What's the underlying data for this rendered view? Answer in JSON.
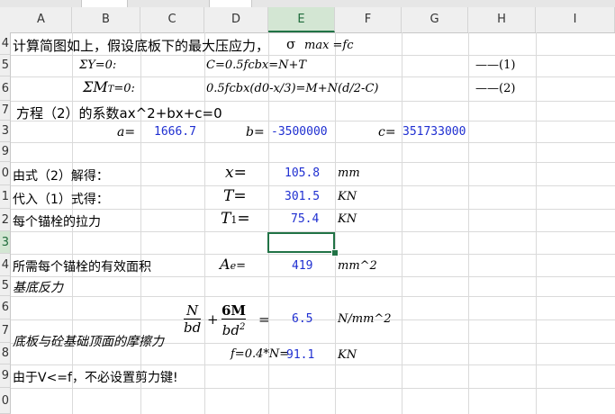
{
  "columns": [
    "A",
    "B",
    "C",
    "D",
    "E",
    "F",
    "G",
    "H",
    "I"
  ],
  "rows": [
    "4",
    "5",
    "6",
    "7",
    "8",
    "9",
    "0",
    "1",
    "2",
    "3",
    "4",
    "5",
    "6",
    "7",
    "8",
    "9",
    "0"
  ],
  "row_labels": {
    "r4": "4",
    "r5": "5",
    "r6": "6",
    "r7": "7",
    "r8": "3",
    "r9": "9",
    "r10": "0",
    "r11": "1",
    "r12": "2",
    "r13": "3",
    "r14": "4",
    "r15": "5",
    "r16": "6",
    "r17": "7",
    "r18": "8",
    "r19": "9",
    "r20": "0"
  },
  "cells": {
    "line1": "计算简图如上，假设底板下的最大压应力，",
    "sigma": "σ",
    "sigma_expr": "max =fc",
    "sumY": "ΣY=0:",
    "eqC": "C=0.5fcbx=N+T",
    "label1": "——(1)",
    "sumM": "ΣM",
    "sumM_sub": "T",
    "sumM_rest": "=0:",
    "eqM": "0.5fcbx(d0-x/3)=M+N(d/2-C)",
    "label2": "——(2)",
    "coef_text": "方程（2）的系数ax^2+bx+c=0",
    "a_label": "a=",
    "a_value": "1666.7",
    "b_label": "b=",
    "b_value": "-3500000",
    "c_label": "c=",
    "c_value": "351733000",
    "solve_text": "由式（2）解得：",
    "x_label": "x=",
    "x_value": "105.8",
    "x_unit": "mm",
    "sub_text": "代入（1）式得：",
    "T_label": "T=",
    "T_value": "301.5",
    "T_unit": "KN",
    "anchor_text": "每个锚栓的拉力",
    "T1_label": "T",
    "T1_sub": "1",
    "T1_eq": "=",
    "T1_value": "75.4",
    "T1_unit": "KN",
    "area_text": "所需每个锚栓的有效面积",
    "Ae_label": "A",
    "Ae_sub": "e",
    "Ae_eq": "=",
    "Ae_value": "419",
    "Ae_unit": "mm^2",
    "base_reaction": "基底反力",
    "frac1_num": "N",
    "frac1_den": "bd",
    "plus": "+",
    "frac2_num": "6M",
    "frac2_den": "bd",
    "frac2_pow": "2",
    "eq_sign": "=",
    "stress_value": "6.5",
    "stress_unit": "N/mm^2",
    "friction_text": "底板与砼基础顶面的摩擦力",
    "f_label": "f=0.4*N=",
    "f_value": "91.1",
    "f_unit": "KN",
    "conclusion": "由于V<=f，不必设置剪力键!"
  }
}
